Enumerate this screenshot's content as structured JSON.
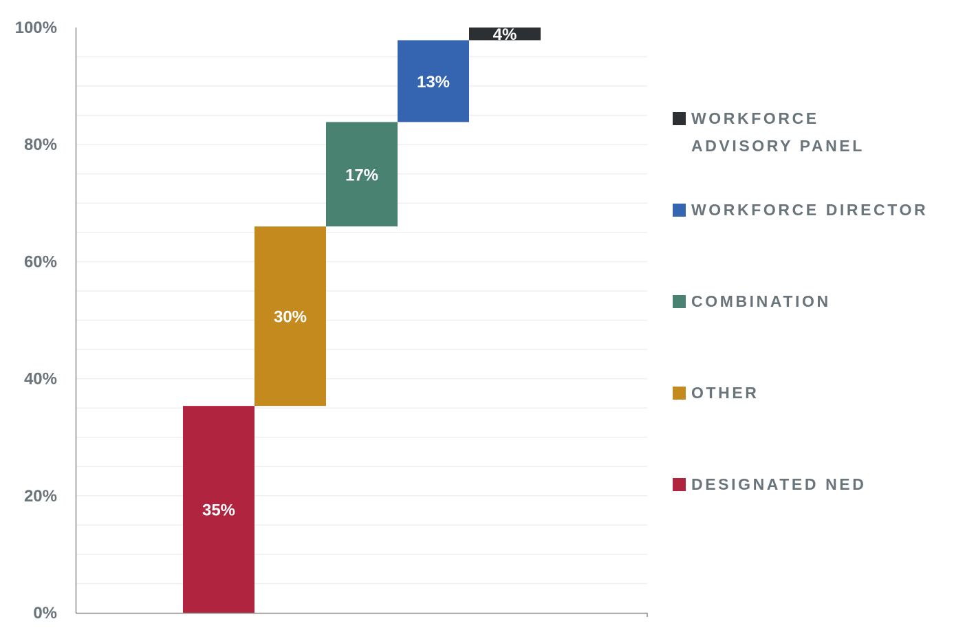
{
  "chart_data": {
    "type": "bar",
    "subtype": "waterfall-stacked",
    "title": "",
    "xlabel": "",
    "ylabel": "",
    "ylim": [
      0,
      100
    ],
    "y_ticks": [
      "0%",
      "20%",
      "40%",
      "60%",
      "80%",
      "100%"
    ],
    "y_tick_values": [
      0,
      20,
      40,
      60,
      80,
      100
    ],
    "minor_grid_step": 5,
    "grid": true,
    "legend_position": "right",
    "series": [
      {
        "name": "DESIGNATED NED",
        "value": 35,
        "label": "35%",
        "color": "#b0243f"
      },
      {
        "name": "OTHER",
        "value": 30,
        "label": "30%",
        "color": "#c48a1e"
      },
      {
        "name": "COMBINATION",
        "value": 17,
        "label": "17%",
        "color": "#4a8271"
      },
      {
        "name": "WORKFORCE DIRECTOR",
        "value": 13,
        "label": "13%",
        "color": "#3565b0"
      },
      {
        "name": "WORKFORCE ADVISORY PANEL",
        "value": 4,
        "label": "4%",
        "color": "#2d3033"
      }
    ],
    "legend": [
      {
        "line1": "WORKFORCE",
        "line2": "ADVISORY PANEL",
        "color": "#2d3033"
      },
      {
        "line1": "WORKFORCE DIRECTOR",
        "line2": "",
        "color": "#3565b0"
      },
      {
        "line1": "COMBINATION",
        "line2": "",
        "color": "#4a8271"
      },
      {
        "line1": "OTHER",
        "line2": "",
        "color": "#c48a1e"
      },
      {
        "line1": "DESIGNATED NED",
        "line2": "",
        "color": "#b0243f"
      }
    ]
  }
}
